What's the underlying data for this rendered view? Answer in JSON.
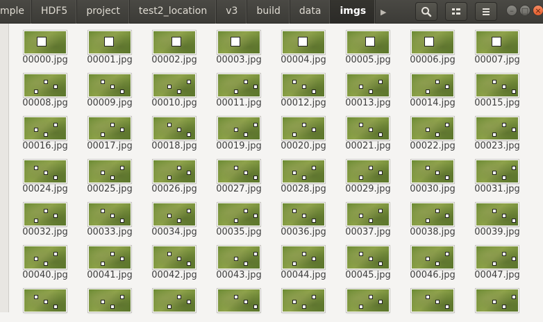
{
  "breadcrumbs": [
    "mple",
    "HDF5",
    "project",
    "test2_location",
    "v3",
    "build",
    "data",
    "imgs"
  ],
  "active_crumb": "imgs",
  "toolbar": {
    "icons": [
      "search-icon",
      "view-list-icon",
      "menu-icon"
    ]
  },
  "window_controls": [
    "minimize-icon",
    "maximize-icon",
    "close-icon"
  ],
  "files": [
    "00000.jpg",
    "00001.jpg",
    "00002.jpg",
    "00003.jpg",
    "00004.jpg",
    "00005.jpg",
    "00006.jpg",
    "00007.jpg",
    "00008.jpg",
    "00009.jpg",
    "00010.jpg",
    "00011.jpg",
    "00012.jpg",
    "00013.jpg",
    "00014.jpg",
    "00015.jpg",
    "00016.jpg",
    "00017.jpg",
    "00018.jpg",
    "00019.jpg",
    "00020.jpg",
    "00021.jpg",
    "00022.jpg",
    "00023.jpg",
    "00024.jpg",
    "00025.jpg",
    "00026.jpg",
    "00027.jpg",
    "00028.jpg",
    "00029.jpg",
    "00030.jpg",
    "00031.jpg",
    "00032.jpg",
    "00033.jpg",
    "00034.jpg",
    "00035.jpg",
    "00036.jpg",
    "00037.jpg",
    "00038.jpg",
    "00039.jpg",
    "00040.jpg",
    "00041.jpg",
    "00042.jpg",
    "00043.jpg",
    "00044.jpg",
    "00045.jpg",
    "00046.jpg",
    "00047.jpg",
    "",
    "",
    "",
    "",
    "",
    "",
    "",
    ""
  ]
}
